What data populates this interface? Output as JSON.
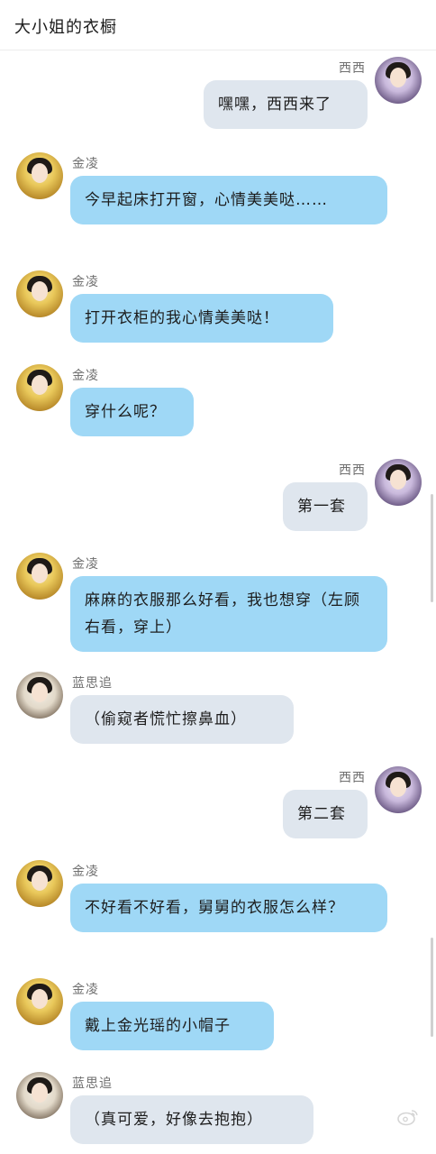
{
  "header": {
    "title": "大小姐的衣橱"
  },
  "messages": [
    {
      "side": "right",
      "avatar": "xi",
      "sender": "西西",
      "text": "嘿嘿，西西来了",
      "bubble": "gray"
    },
    {
      "side": "left",
      "avatar": "jin",
      "sender": "金凌",
      "text": "今早起床打开窗，心情美美哒……",
      "bubble": "blue"
    },
    {
      "side": "left",
      "avatar": "jin",
      "sender": "金凌",
      "text": "打开衣柜的我心情美美哒！",
      "bubble": "blue"
    },
    {
      "side": "left",
      "avatar": "jin",
      "sender": "金凌",
      "text": "穿什么呢？",
      "bubble": "blue"
    },
    {
      "side": "right",
      "avatar": "xi",
      "sender": "西西",
      "text": "第一套",
      "bubble": "gray"
    },
    {
      "side": "left",
      "avatar": "jin",
      "sender": "金凌",
      "text": "麻麻的衣服那么好看，我也想穿（左顾右看，穿上）",
      "bubble": "blue"
    },
    {
      "side": "left",
      "avatar": "lan",
      "sender": "蓝思追",
      "text": "（偷窥者慌忙擦鼻血）",
      "bubble": "gray"
    },
    {
      "side": "right",
      "avatar": "xi",
      "sender": "西西",
      "text": "第二套",
      "bubble": "gray"
    },
    {
      "side": "left",
      "avatar": "jin",
      "sender": "金凌",
      "text": "不好看不好看，舅舅的衣服怎么样？",
      "bubble": "blue"
    },
    {
      "side": "left",
      "avatar": "jin",
      "sender": "金凌",
      "text": "戴上金光瑶的小帽子",
      "bubble": "blue"
    },
    {
      "side": "left",
      "avatar": "lan",
      "sender": "蓝思追",
      "text": "（真可爱，好像去抱抱）",
      "bubble": "gray"
    }
  ],
  "colors": {
    "bubble_blue": "#9fd8f6",
    "bubble_gray": "#dfe6ee"
  }
}
